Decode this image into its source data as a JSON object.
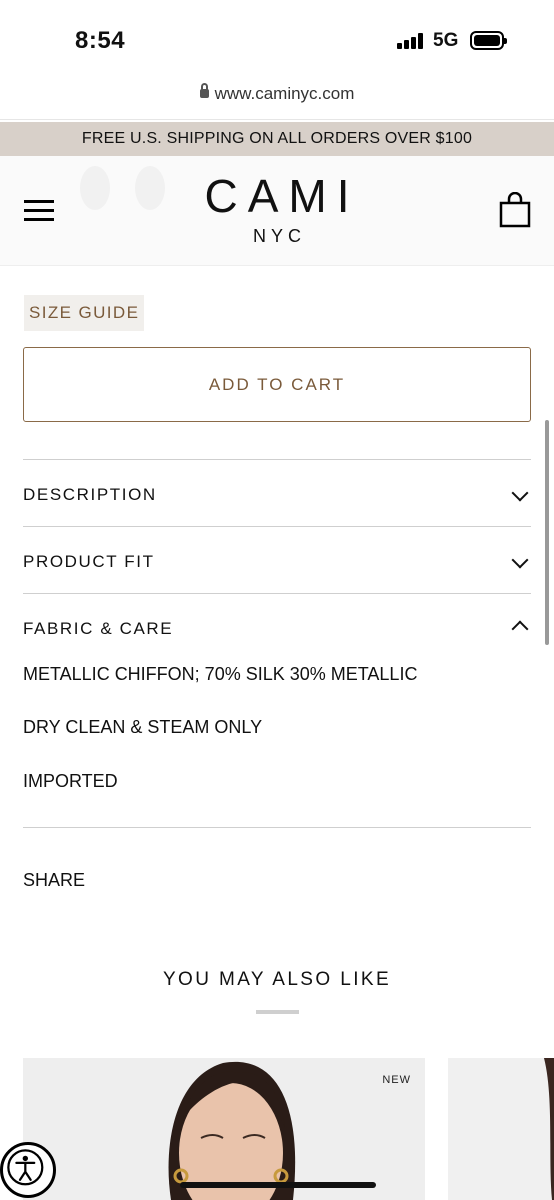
{
  "status_bar": {
    "time": "8:54",
    "network": "5G",
    "battery_icon": "battery-full-icon",
    "signal_icon": "cellular-signal-icon"
  },
  "browser": {
    "url": "www.caminyc.com",
    "lock_icon": "lock-icon"
  },
  "promo": {
    "text": "FREE U.S. SHIPPING ON ALL ORDERS OVER $100"
  },
  "header": {
    "logo_main": "CAMI",
    "logo_sub": "NYC",
    "menu_icon": "hamburger-menu-icon",
    "cart_icon": "shopping-bag-icon"
  },
  "product": {
    "size_guide_label": "SIZE GUIDE",
    "add_to_cart_label": "ADD TO CART",
    "accordions": [
      {
        "title": "DESCRIPTION",
        "expanded": false
      },
      {
        "title": "PRODUCT FIT",
        "expanded": false
      },
      {
        "title": "FABRIC & CARE",
        "expanded": true
      }
    ],
    "fabric_care": [
      "METALLIC CHIFFON; 70% SILK 30% METALLIC",
      "DRY CLEAN & STEAM ONLY",
      "IMPORTED"
    ],
    "share_label": "SHARE"
  },
  "recommendations": {
    "title": "YOU MAY ALSO LIKE",
    "cards": [
      {
        "badge": "NEW"
      }
    ]
  },
  "colors": {
    "accent_brown": "#7a5a3a",
    "promo_bg": "#d8d0c9"
  },
  "accessibility_icon": "accessibility-icon"
}
